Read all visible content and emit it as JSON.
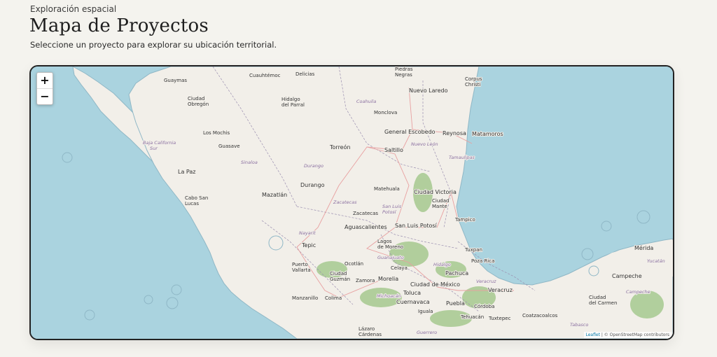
{
  "header": {
    "eyebrow": "Exploración espacial",
    "title": "Mapa de Proyectos",
    "subtitle": "Seleccione un proyecto para explorar su ubicación territorial."
  },
  "map": {
    "zoom_in": "+",
    "zoom_out": "−",
    "attribution_link": "Leaflet",
    "attribution_text": " | © OpenStreetMap contributors",
    "colors": {
      "water": "#aad3df",
      "land": "#f2efe9",
      "forest": "#a6c98f",
      "border": "#9b8fb0",
      "road": "#e8a0a0"
    },
    "cities": [
      {
        "name": "Piedras",
        "size": 7
      },
      {
        "name": "Negras",
        "size": 7
      },
      {
        "name": "Nuevo Laredo",
        "size": 8
      },
      {
        "name": "Corpus",
        "size": 7
      },
      {
        "name": "Christi",
        "size": 7
      },
      {
        "name": "Cuauhtémoc",
        "size": 7
      },
      {
        "name": "Delicias",
        "size": 7
      },
      {
        "name": "Guaymas",
        "size": 7
      },
      {
        "name": "Ciudad",
        "size": 7
      },
      {
        "name": "Obregón",
        "size": 7
      },
      {
        "name": "Hidalgo",
        "size": 7
      },
      {
        "name": "del Parral",
        "size": 7
      },
      {
        "name": "Monclova",
        "size": 7
      },
      {
        "name": "General Escobedo",
        "size": 8
      },
      {
        "name": "Reynosa",
        "size": 8
      },
      {
        "name": "Matamoros",
        "size": 8
      },
      {
        "name": "Los Mochis",
        "size": 7
      },
      {
        "name": "Guasave",
        "size": 7
      },
      {
        "name": "Torreón",
        "size": 8
      },
      {
        "name": "Saltillo",
        "size": 8
      },
      {
        "name": "La Paz",
        "size": 8
      },
      {
        "name": "Durango",
        "size": 8
      },
      {
        "name": "Matehuala",
        "size": 7
      },
      {
        "name": "Ciudad Victoria",
        "size": 8
      },
      {
        "name": "Cabo San",
        "size": 7
      },
      {
        "name": "Lucas",
        "size": 7
      },
      {
        "name": "Mazatlán",
        "size": 8
      },
      {
        "name": "Ciudad",
        "size": 7
      },
      {
        "name": "Mante",
        "size": 7
      },
      {
        "name": "Zacatecas",
        "size": 7
      },
      {
        "name": "Tampico",
        "size": 7
      },
      {
        "name": "Aguascalientes",
        "size": 8
      },
      {
        "name": "San Luis Potosí",
        "size": 8
      },
      {
        "name": "Tepic",
        "size": 8
      },
      {
        "name": "Lagos",
        "size": 7
      },
      {
        "name": "de Moreno",
        "size": 7
      },
      {
        "name": "Tuxpan",
        "size": 7
      },
      {
        "name": "Mérida",
        "size": 8
      },
      {
        "name": "Poza Rica",
        "size": 7
      },
      {
        "name": "Puerto",
        "size": 7
      },
      {
        "name": "Vallarta",
        "size": 7
      },
      {
        "name": "Ocotlán",
        "size": 7
      },
      {
        "name": "Celaya",
        "size": 7
      },
      {
        "name": "Ciudad",
        "size": 7
      },
      {
        "name": "Guzmán",
        "size": 7
      },
      {
        "name": "Zamora",
        "size": 7
      },
      {
        "name": "Morelia",
        "size": 8
      },
      {
        "name": "Pachuca",
        "size": 8
      },
      {
        "name": "Campeche",
        "size": 8
      },
      {
        "name": "Ciudad de México",
        "size": 8
      },
      {
        "name": "Veracruz",
        "size": 8
      },
      {
        "name": "Toluca",
        "size": 8
      },
      {
        "name": "Manzanillo",
        "size": 7
      },
      {
        "name": "Colima",
        "size": 7
      },
      {
        "name": "Cuernavaca",
        "size": 8
      },
      {
        "name": "Puebla",
        "size": 8
      },
      {
        "name": "Ciudad",
        "size": 7
      },
      {
        "name": "del Carmen",
        "size": 7
      },
      {
        "name": "Córdoba",
        "size": 7
      },
      {
        "name": "Iguala",
        "size": 7
      },
      {
        "name": "Tehuacán",
        "size": 7
      },
      {
        "name": "Tuxtepec",
        "size": 7
      },
      {
        "name": "Coatzacoalcos",
        "size": 7
      },
      {
        "name": "Lázaro",
        "size": 7
      },
      {
        "name": "Cárdenas",
        "size": 7
      }
    ],
    "regions": [
      "Coahuila",
      "Baja California",
      "Sur",
      "Nuevo León",
      "Tamaulipas",
      "Sinaloa",
      "Durango",
      "Zacatecas",
      "San Luis",
      "Potosí",
      "Nayarit",
      "Guanajuato",
      "Hidalgo",
      "Veracruz",
      "Michoacán",
      "Guerrero",
      "Tabasco",
      "Yucatán",
      "Campeche"
    ]
  }
}
